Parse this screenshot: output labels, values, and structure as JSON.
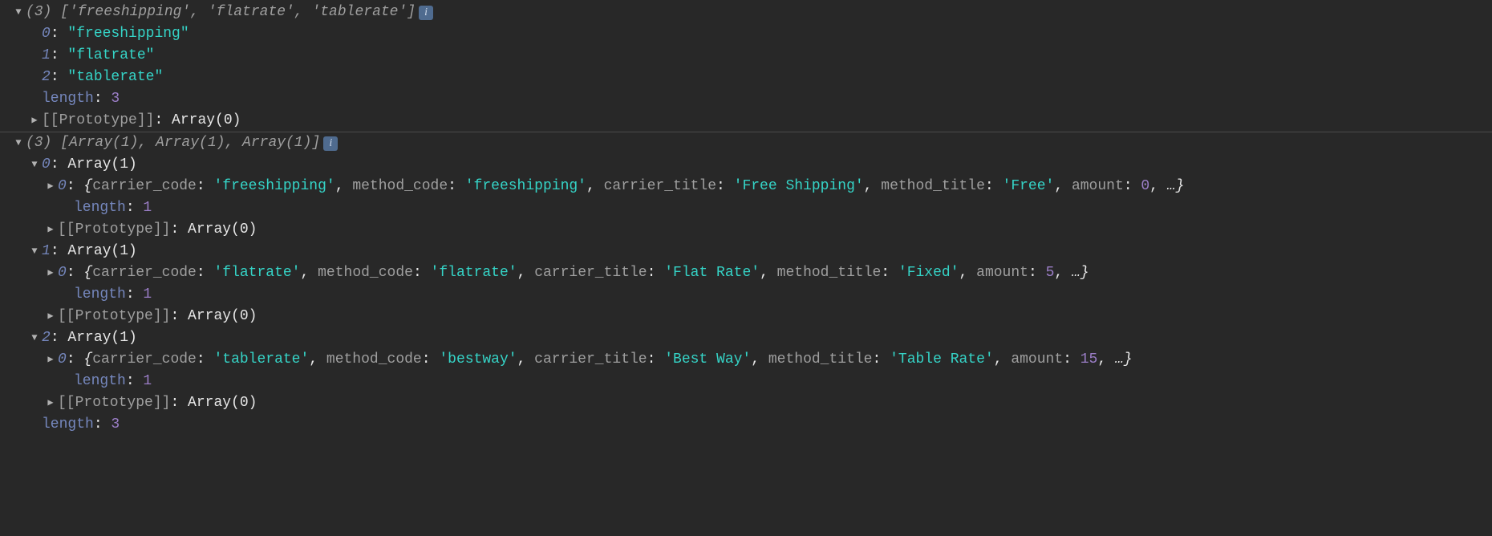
{
  "glyphs": {
    "down": "▼",
    "right": "▶",
    "info": "i"
  },
  "entry1": {
    "summary": "(3) ['freeshipping', 'flatrate', 'tablerate']",
    "items": [
      {
        "idx": "0",
        "val": "\"freeshipping\""
      },
      {
        "idx": "1",
        "val": "\"flatrate\""
      },
      {
        "idx": "2",
        "val": "\"tablerate\""
      }
    ],
    "length_label": "length",
    "length_val": "3",
    "proto_label": "[[Prototype]]",
    "proto_val": "Array(0)"
  },
  "entry2": {
    "summary": "(3) [Array(1), Array(1), Array(1)]",
    "groups": [
      {
        "idx": "0",
        "head_val": "Array(1)",
        "obj_idx": "0",
        "props": [
          {
            "k": "carrier_code",
            "v": "'freeshipping'",
            "t": "str"
          },
          {
            "k": "method_code",
            "v": "'freeshipping'",
            "t": "str"
          },
          {
            "k": "carrier_title",
            "v": "'Free Shipping'",
            "t": "str"
          },
          {
            "k": "method_title",
            "v": "'Free'",
            "t": "str"
          },
          {
            "k": "amount",
            "v": "0",
            "t": "num"
          }
        ],
        "length_label": "length",
        "length_val": "1",
        "proto_label": "[[Prototype]]",
        "proto_val": "Array(0)"
      },
      {
        "idx": "1",
        "head_val": "Array(1)",
        "obj_idx": "0",
        "props": [
          {
            "k": "carrier_code",
            "v": "'flatrate'",
            "t": "str"
          },
          {
            "k": "method_code",
            "v": "'flatrate'",
            "t": "str"
          },
          {
            "k": "carrier_title",
            "v": "'Flat Rate'",
            "t": "str"
          },
          {
            "k": "method_title",
            "v": "'Fixed'",
            "t": "str"
          },
          {
            "k": "amount",
            "v": "5",
            "t": "num"
          }
        ],
        "length_label": "length",
        "length_val": "1",
        "proto_label": "[[Prototype]]",
        "proto_val": "Array(0)"
      },
      {
        "idx": "2",
        "head_val": "Array(1)",
        "obj_idx": "0",
        "props": [
          {
            "k": "carrier_code",
            "v": "'tablerate'",
            "t": "str"
          },
          {
            "k": "method_code",
            "v": "'bestway'",
            "t": "str"
          },
          {
            "k": "carrier_title",
            "v": "'Best Way'",
            "t": "str"
          },
          {
            "k": "method_title",
            "v": "'Table Rate'",
            "t": "str"
          },
          {
            "k": "amount",
            "v": "15",
            "t": "num"
          }
        ],
        "length_label": "length",
        "length_val": "1",
        "proto_label": "[[Prototype]]",
        "proto_val": "Array(0)"
      }
    ],
    "length_label": "length",
    "length_val": "3"
  }
}
